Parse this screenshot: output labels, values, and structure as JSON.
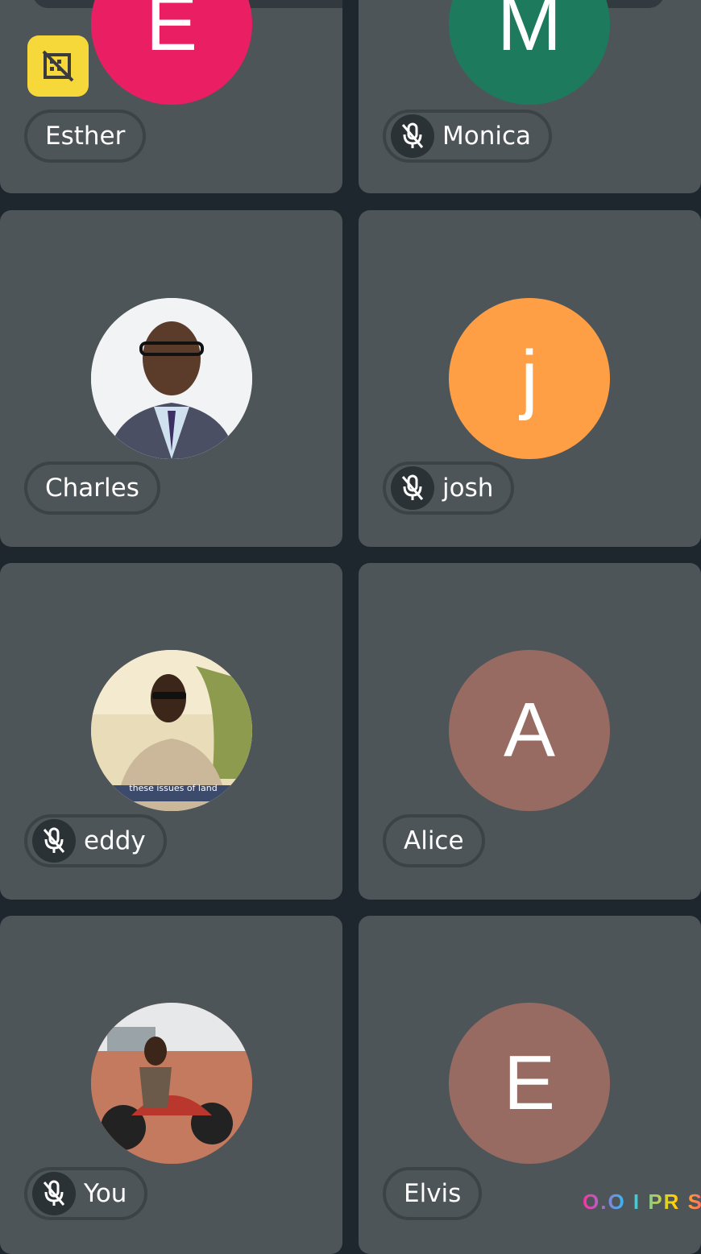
{
  "participants": [
    {
      "name": "Esther",
      "initial": "E",
      "color": "#e91e63",
      "muted": false,
      "presenting_icon": true
    },
    {
      "name": "Monica",
      "initial": "M",
      "color": "#1e7a5c",
      "muted": true
    },
    {
      "name": "Charles",
      "initial": "",
      "color": "#e9eef2",
      "muted": false,
      "photo": true
    },
    {
      "name": "josh",
      "initial": "j",
      "color": "#ff9f45",
      "muted": true
    },
    {
      "name": "eddy",
      "initial": "",
      "color": "#d9c89a",
      "muted": true,
      "photo": true,
      "photo_caption": "these issues of land"
    },
    {
      "name": "Alice",
      "initial": "A",
      "color": "#986b62",
      "muted": false
    },
    {
      "name": "You",
      "initial": "",
      "color": "#b96a55",
      "muted": true,
      "photo": true
    },
    {
      "name": "Elvis",
      "initial": "E",
      "color": "#986b62",
      "muted": false
    }
  ],
  "watermark": "O.O I PR SS",
  "icons": {
    "muted": "mic-off-icon",
    "presenting": "no-video-icon"
  }
}
